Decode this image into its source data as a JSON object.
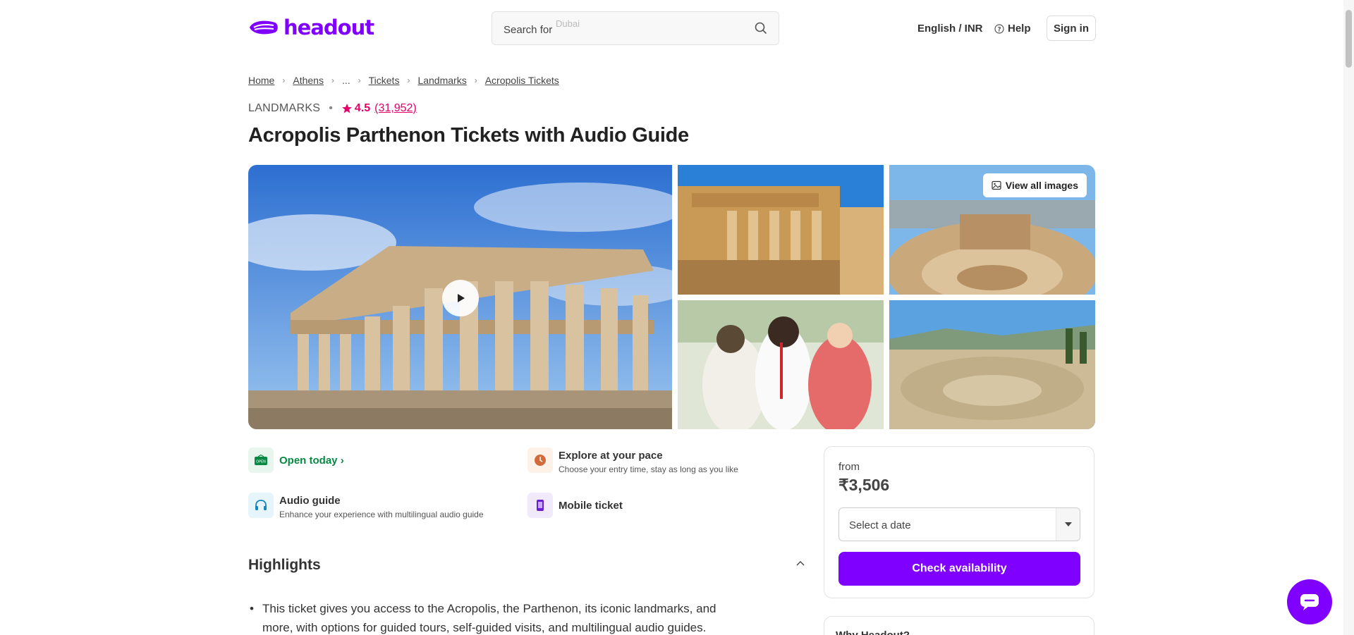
{
  "header": {
    "logo_text": "headout",
    "search_label": "Search for",
    "search_rotating": "Dubai",
    "language": "English / INR",
    "help": "Help",
    "sign_in": "Sign in"
  },
  "breadcrumb": [
    "Home",
    "Athens",
    "...",
    "Tickets",
    "Landmarks",
    "Acropolis Tickets"
  ],
  "meta": {
    "category": "LANDMARKS",
    "rating": "4.5",
    "rating_count": "(31,952)"
  },
  "title": "Acropolis Parthenon Tickets with Audio Guide",
  "gallery": {
    "view_all": "View all images"
  },
  "features": {
    "open_today": "Open today",
    "explore_title": "Explore at your pace",
    "explore_sub": "Choose your entry time, stay as long as you like",
    "audio_title": "Audio guide",
    "audio_sub": "Enhance your experience with multilingual audio guide",
    "mobile_title": "Mobile ticket",
    "open_badge": "OPEN"
  },
  "highlights": {
    "heading": "Highlights",
    "items": [
      "This ticket gives you access to the Acropolis, the Parthenon, its iconic landmarks, and more, with options for guided tours, self-guided visits, and multilingual audio guides."
    ]
  },
  "booking": {
    "from": "from",
    "price": "₹3,506",
    "date_placeholder": "Select a date",
    "check_button": "Check availability"
  },
  "why": {
    "title": "Why Headout?"
  },
  "colors": {
    "brand": "#8000ff",
    "rating": "#e5006a",
    "open_green": "#078843"
  }
}
